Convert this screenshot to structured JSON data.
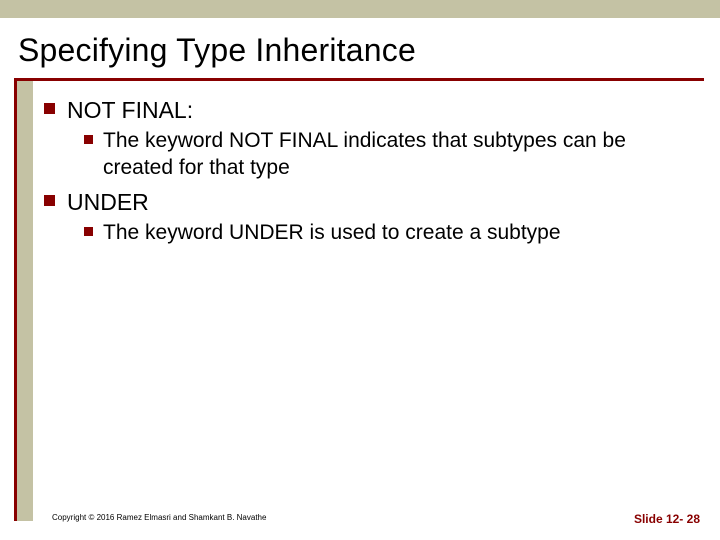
{
  "title": "Specifying Type Inheritance",
  "bullets": [
    {
      "label": "NOT FINAL:",
      "sub": [
        "The keyword NOT FINAL indicates that subtypes can be created for that type"
      ]
    },
    {
      "label": "UNDER",
      "sub": [
        "The keyword UNDER is used to create a subtype"
      ]
    }
  ],
  "footer": {
    "copyright": "Copyright © 2016 Ramez Elmasri and Shamkant B. Navathe",
    "slide_number": "Slide 12- 28"
  }
}
